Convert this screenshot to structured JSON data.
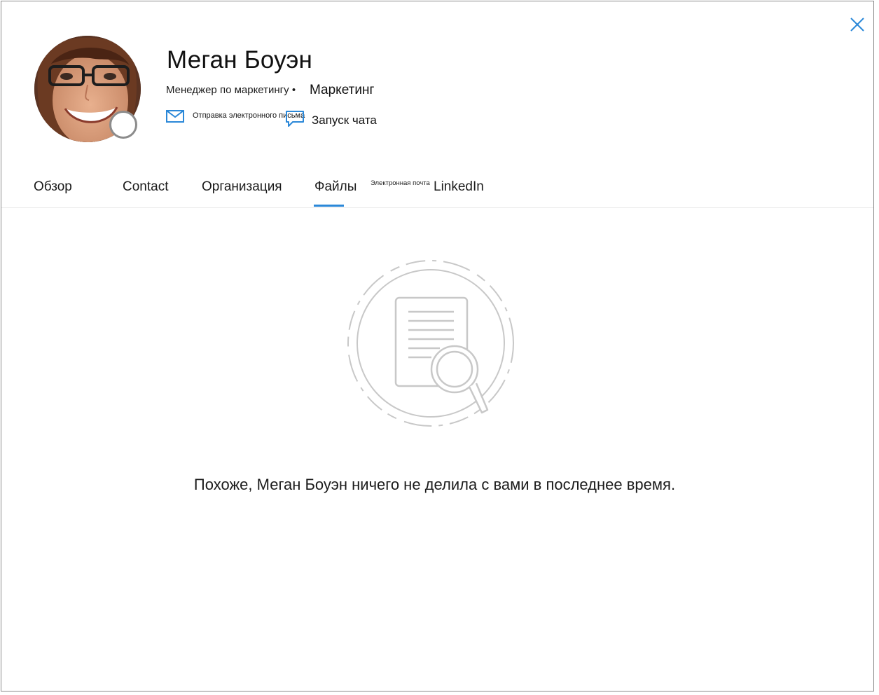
{
  "profile": {
    "name": "Меган Боуэн",
    "job_title": "Менеджер по маркетингу •",
    "department": "Маркетинг",
    "presence": "offline"
  },
  "actions": {
    "email_label": "Отправка электронного письма",
    "chat_label": "Запуск чата"
  },
  "tabs": [
    {
      "label": "Обзор",
      "selected": false
    },
    {
      "label": "Contact",
      "selected": false
    },
    {
      "label": "Организация",
      "selected": false
    },
    {
      "label": "Файлы",
      "selected": true
    },
    {
      "label": "Электронная почта",
      "selected": false
    },
    {
      "label": "LinkedIn",
      "selected": false
    }
  ],
  "files": {
    "empty_message": "Похоже, Меган Боуэн ничего не делила с вами в последнее время."
  },
  "icons": {
    "close": "close-icon",
    "email": "mail-icon",
    "chat": "chat-icon",
    "illustration": "document-search-icon"
  },
  "colors": {
    "accent": "#2b88d8",
    "illustration_stroke": "#c8c8c8",
    "presence_ring": "#8c8c8c"
  }
}
